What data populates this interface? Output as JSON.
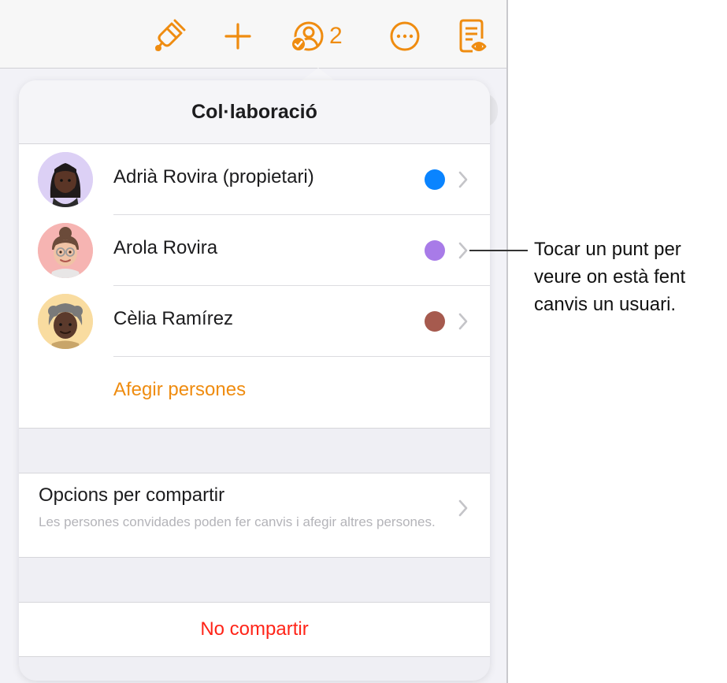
{
  "toolbar": {
    "buttons": [
      {
        "icon": "paintbrush-icon"
      },
      {
        "icon": "plus-icon"
      },
      {
        "icon": "collaboration-icon",
        "count": "2"
      },
      {
        "icon": "more-icon"
      },
      {
        "icon": "reader-view-icon"
      }
    ],
    "accent_color": "#ef8c10"
  },
  "popover": {
    "title": "Col·laboració",
    "participants": [
      {
        "name": "Adrià Rovira (propietari)",
        "color": "#0a84ff",
        "avatar": "memoji-dark-braids"
      },
      {
        "name": "Arola Rovira",
        "color": "#a87be8",
        "avatar": "memoji-glasses"
      },
      {
        "name": "Cèlia Ramírez",
        "color": "#a65a4e",
        "avatar": "memoji-dark-gray-hair"
      }
    ],
    "add_people_label": "Afegir persones",
    "share_options": {
      "title": "Opcions per compartir",
      "description": "Les persones convidades poden fer canvis i afegir altres persones."
    },
    "stop_sharing_label": "No compartir"
  },
  "callout": {
    "lines": [
      "Tocar un punt per",
      "veure on està fent",
      "canvis un usuari."
    ]
  }
}
